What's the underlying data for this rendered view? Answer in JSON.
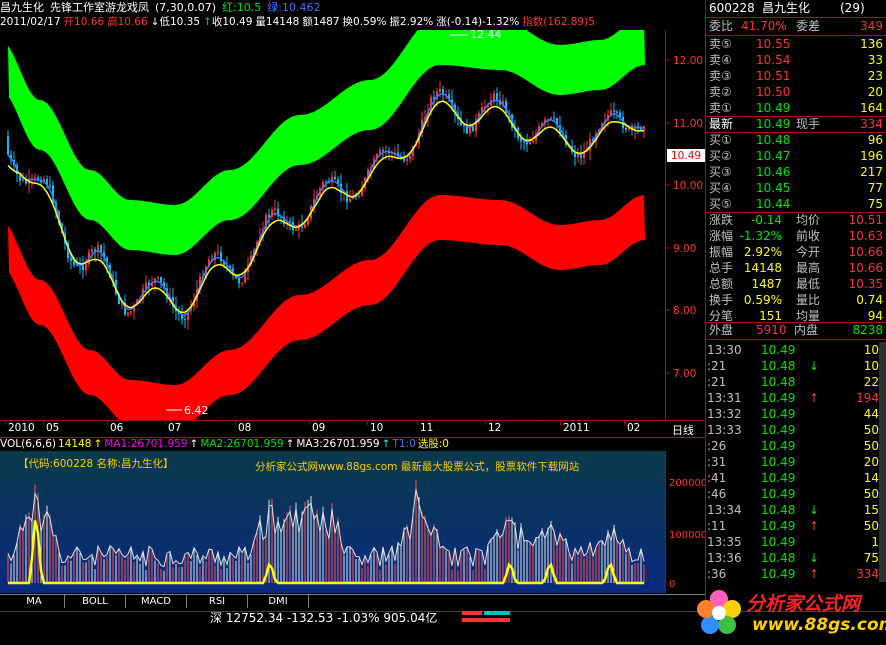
{
  "title": {
    "stock_name": "昌九生化",
    "formula_name": "先锋工作室游龙戏凤",
    "params": "(7,30,0.07)",
    "red_label": "红:",
    "red_value": "10.5",
    "green_label": "绿:",
    "green_value": "10.462"
  },
  "info": {
    "date": "2011/02/17",
    "open_label": "开",
    "open": "10.66",
    "high_label": "高",
    "high": "10.66",
    "low_label": "低",
    "low": "10.35",
    "close_label": "收",
    "close": "10.49",
    "volume_label": "量",
    "volume": "14148",
    "amount_label": "额",
    "amount": "1487",
    "turnover_label": "换",
    "turnover": "0.59%",
    "amplitude_label": "振",
    "amplitude": "2.92%",
    "change_label": "涨",
    "change": "(-0.14)-1.32%",
    "index_label": "指数",
    "index_value": "(162.89)",
    "index_suffix": "5"
  },
  "price_axis": {
    "ticks": [
      "12.00",
      "11.00",
      "10.00",
      "9.00",
      "8.00",
      "7.00"
    ],
    "current": "10.49",
    "period_label": "日线"
  },
  "chart_annotations": {
    "high_label": "12.44",
    "low_label": "6.42"
  },
  "date_axis": [
    "2010",
    "05",
    "06",
    "07",
    "08",
    "09",
    "10",
    "11",
    "12",
    "2011",
    "02"
  ],
  "vol_legend": {
    "title": "VOL(6,6,6)",
    "vol": "14148",
    "ma1": "MA1:26701.959",
    "ma2": "MA2:26701.959",
    "ma3": "MA3:26701.959",
    "t1": "T1:0",
    "select": "选股:0"
  },
  "vol_overlay": {
    "code": "【代码:600228 名称:昌九生化】",
    "ad": "分析家公式网www.88gs.com 最新最大股票公式，股票软件下载网站"
  },
  "vol_axis": [
    "200000",
    "100000",
    "0"
  ],
  "tabs": [
    "MA",
    "BOLL",
    "MACD",
    "RSI",
    "DMI"
  ],
  "index_line": {
    "market": "深",
    "value": "12752.34",
    "change": "-132.53",
    "pct": "-1.03%",
    "amount": "905.04亿"
  },
  "panel": {
    "code": "600228",
    "name": "昌九生化",
    "count": "(29)",
    "weibi_label": "委比",
    "weibi": "41.70%",
    "weicha_label": "委差",
    "weicha": "349",
    "sells": [
      {
        "label": "卖⑤",
        "price": "10.55",
        "vol": "136"
      },
      {
        "label": "卖④",
        "price": "10.54",
        "vol": "33"
      },
      {
        "label": "卖③",
        "price": "10.51",
        "vol": "23"
      },
      {
        "label": "卖②",
        "price": "10.50",
        "vol": "20"
      },
      {
        "label": "卖①",
        "price": "10.49",
        "vol": "164"
      }
    ],
    "latest_label": "最新",
    "latest": "10.49",
    "xianshou_label": "现手",
    "xianshou": "334",
    "buys": [
      {
        "label": "买①",
        "price": "10.48",
        "vol": "96"
      },
      {
        "label": "买②",
        "price": "10.47",
        "vol": "196"
      },
      {
        "label": "买③",
        "price": "10.46",
        "vol": "217"
      },
      {
        "label": "买④",
        "price": "10.45",
        "vol": "77"
      },
      {
        "label": "买⑤",
        "price": "10.44",
        "vol": "75"
      }
    ],
    "stats": [
      {
        "l1": "涨跌",
        "v1": "-0.14",
        "l2": "均价",
        "v2": "10.51"
      },
      {
        "l1": "涨幅",
        "v1": "-1.32%",
        "l2": "前收",
        "v2": "10.63"
      },
      {
        "l1": "振幅",
        "v1": "2.92%",
        "l2": "今开",
        "v2": "10.66"
      },
      {
        "l1": "总手",
        "v1": "14148",
        "l2": "最高",
        "v2": "10.66"
      },
      {
        "l1": "总额",
        "v1": "1487",
        "l2": "最低",
        "v2": "10.35"
      },
      {
        "l1": "换手",
        "v1": "0.59%",
        "l2": "量比",
        "v2": "0.74"
      },
      {
        "l1": "分笔",
        "v1": "151",
        "l2": "均量",
        "v2": "94"
      }
    ],
    "waipan_label": "外盘",
    "waipan": "5910",
    "neipan_label": "内盘",
    "neipan": "8238",
    "ticks": [
      {
        "time": "13:30",
        "price": "10.49",
        "arrow": "",
        "vol": "10",
        "color": "#00e600"
      },
      {
        "time": ":21",
        "price": "10.48",
        "arrow": "↓",
        "vol": "10",
        "color": "#00e600"
      },
      {
        "time": ":21",
        "price": "10.48",
        "arrow": "",
        "vol": "22",
        "color": "#00e600"
      },
      {
        "time": "13:31",
        "price": "10.49",
        "arrow": "↑",
        "vol": "194",
        "color": "#ff3232"
      },
      {
        "time": "13:32",
        "price": "10.49",
        "arrow": "",
        "vol": "44",
        "color": "#00e600"
      },
      {
        "time": "13:33",
        "price": "10.49",
        "arrow": "",
        "vol": "50",
        "color": "#00e600"
      },
      {
        "time": ":26",
        "price": "10.49",
        "arrow": "",
        "vol": "50",
        "color": "#00e600"
      },
      {
        "time": ":31",
        "price": "10.49",
        "arrow": "",
        "vol": "20",
        "color": "#00e600"
      },
      {
        "time": ":41",
        "price": "10.49",
        "arrow": "",
        "vol": "14",
        "color": "#00e600"
      },
      {
        "time": ":46",
        "price": "10.49",
        "arrow": "",
        "vol": "50",
        "color": "#00e600"
      },
      {
        "time": "13:34",
        "price": "10.48",
        "arrow": "↓",
        "vol": "15",
        "color": "#00e600"
      },
      {
        "time": ":11",
        "price": "10.49",
        "arrow": "↑",
        "vol": "50",
        "color": "#ff3232"
      },
      {
        "time": "13:35",
        "price": "10.49",
        "arrow": "",
        "vol": "1",
        "color": "#00e600"
      },
      {
        "time": "13:36",
        "price": "10.48",
        "arrow": "↓",
        "vol": "75",
        "color": "#00e600"
      },
      {
        "time": ":36",
        "price": "10.49",
        "arrow": "↑",
        "vol": "334",
        "color": "#ff3232"
      }
    ]
  },
  "logo": {
    "text": "分析家公式网",
    "url": "www.88gs.com"
  },
  "colors": {
    "up": "#ff3232",
    "down": "#00e600",
    "band_upper": "#00ff00",
    "band_lower": "#ff0000",
    "grid": "#c00000"
  }
}
